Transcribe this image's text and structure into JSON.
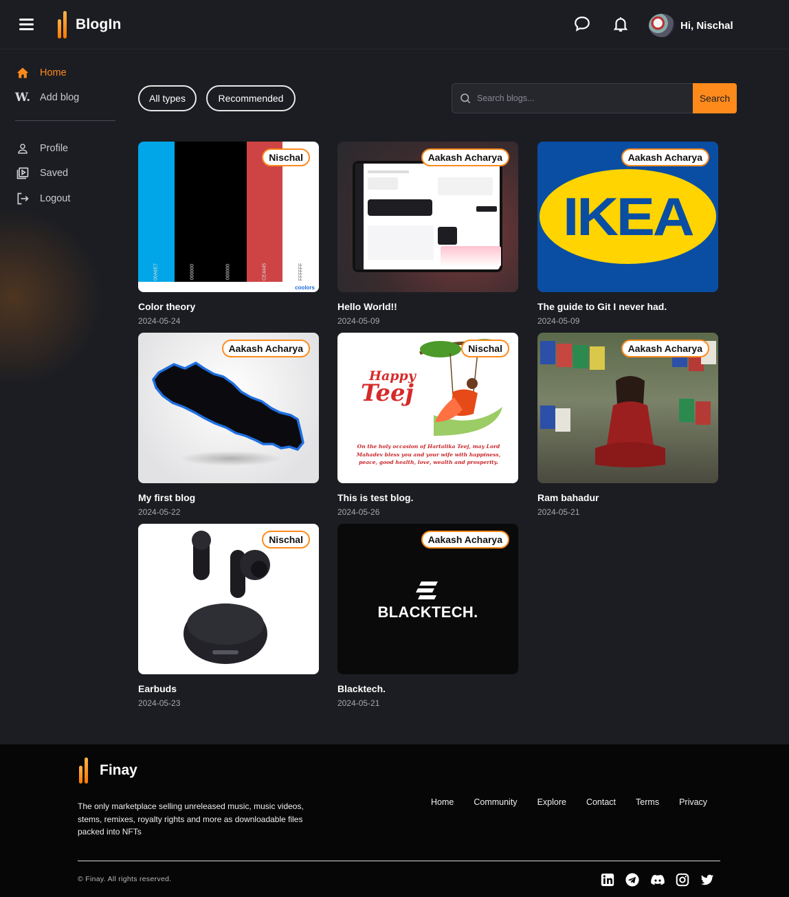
{
  "header": {
    "brand": "BlogIn",
    "greeting": "Hi, Nischal"
  },
  "sidebar": {
    "items": [
      {
        "label": "Home",
        "active": true
      },
      {
        "label": "Add blog"
      },
      {
        "label": "Profile"
      },
      {
        "label": "Saved"
      },
      {
        "label": "Logout"
      }
    ],
    "add_blog_icon_text": "W."
  },
  "filters": {
    "all_types": "All types",
    "recommended": "Recommended"
  },
  "search": {
    "placeholder": "Search blogs...",
    "button": "Search"
  },
  "posts": [
    {
      "author": "Nischal",
      "title": "Color theory",
      "date": "2024-05-24",
      "palette": [
        {
          "hex": "#00A6E7",
          "code": "00A6E7"
        },
        {
          "hex": "#000000",
          "code": "000000"
        },
        {
          "hex": "#000000",
          "code": "000000"
        },
        {
          "hex": "#CE4445",
          "code": "CE4445"
        },
        {
          "hex": "#FFFFFF",
          "code": "FFFFFF"
        }
      ],
      "palette_brand": "coolors"
    },
    {
      "author": "Aakash Acharya",
      "title": "Hello World!!",
      "date": "2024-05-09"
    },
    {
      "author": "Aakash Acharya",
      "title": "The guide to Git I never had.",
      "date": "2024-05-09",
      "logo_text": "IKEA"
    },
    {
      "author": "Aakash Acharya",
      "title": "My first blog",
      "date": "2024-05-22"
    },
    {
      "author": "Nischal",
      "title": "This is test blog.",
      "date": "2024-05-26",
      "teej": {
        "line1": "Happy",
        "line2": "Teej",
        "message": "On the holy occasion of Hartalika Teej, may Lord Mahadev bless you and your wife with happiness, peace, good health, love, wealth and prosperity."
      }
    },
    {
      "author": "Aakash Acharya",
      "title": "Ram bahadur",
      "date": "2024-05-21"
    },
    {
      "author": "Nischal",
      "title": "Earbuds",
      "date": "2024-05-23"
    },
    {
      "author": "Aakash Acharya",
      "title": "Blacktech.",
      "date": "2024-05-21",
      "logo_text": "BLACKTECH."
    }
  ],
  "footer": {
    "brand": "Finay",
    "description": "The only marketplace selling unreleased music, music videos, stems, remixes, royalty rights and more as downloadable files packed into NFTs",
    "links": [
      "Home",
      "Community",
      "Explore",
      "Contact",
      "Terms",
      "Privacy"
    ],
    "copyright": "© Finay. All rights reserved.",
    "social": [
      "linkedin-icon",
      "telegram-icon",
      "discord-icon",
      "instagram-icon",
      "twitter-icon"
    ]
  },
  "colors": {
    "accent": "#ff8a1c",
    "background": "#1c1d22",
    "footer_bg": "#060607"
  }
}
